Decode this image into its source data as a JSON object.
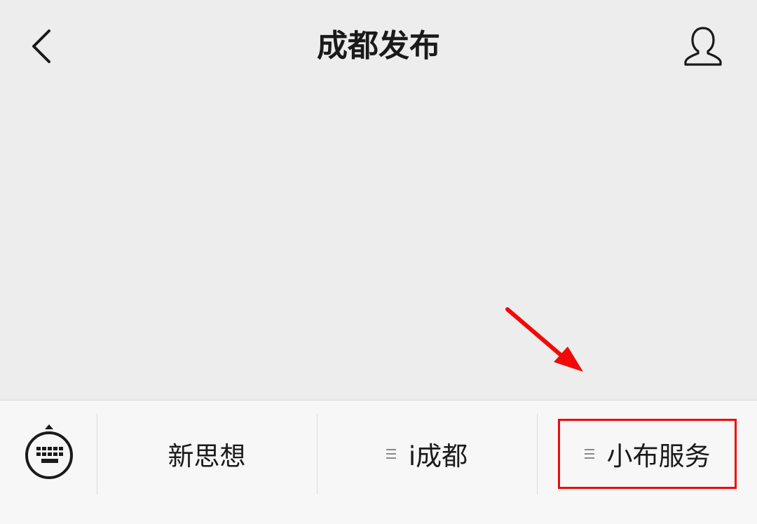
{
  "header": {
    "title": "成都发布",
    "back_icon": "chevron-left-icon",
    "profile_icon": "person-icon"
  },
  "menu": {
    "keyboard_icon": "keyboard-toggle-icon",
    "items": [
      {
        "label": "新思想",
        "has_submenu": false
      },
      {
        "label": "i成都",
        "has_submenu": true
      },
      {
        "label": "小布服务",
        "has_submenu": true
      }
    ]
  },
  "annotation": {
    "color": "#f00a0a"
  }
}
